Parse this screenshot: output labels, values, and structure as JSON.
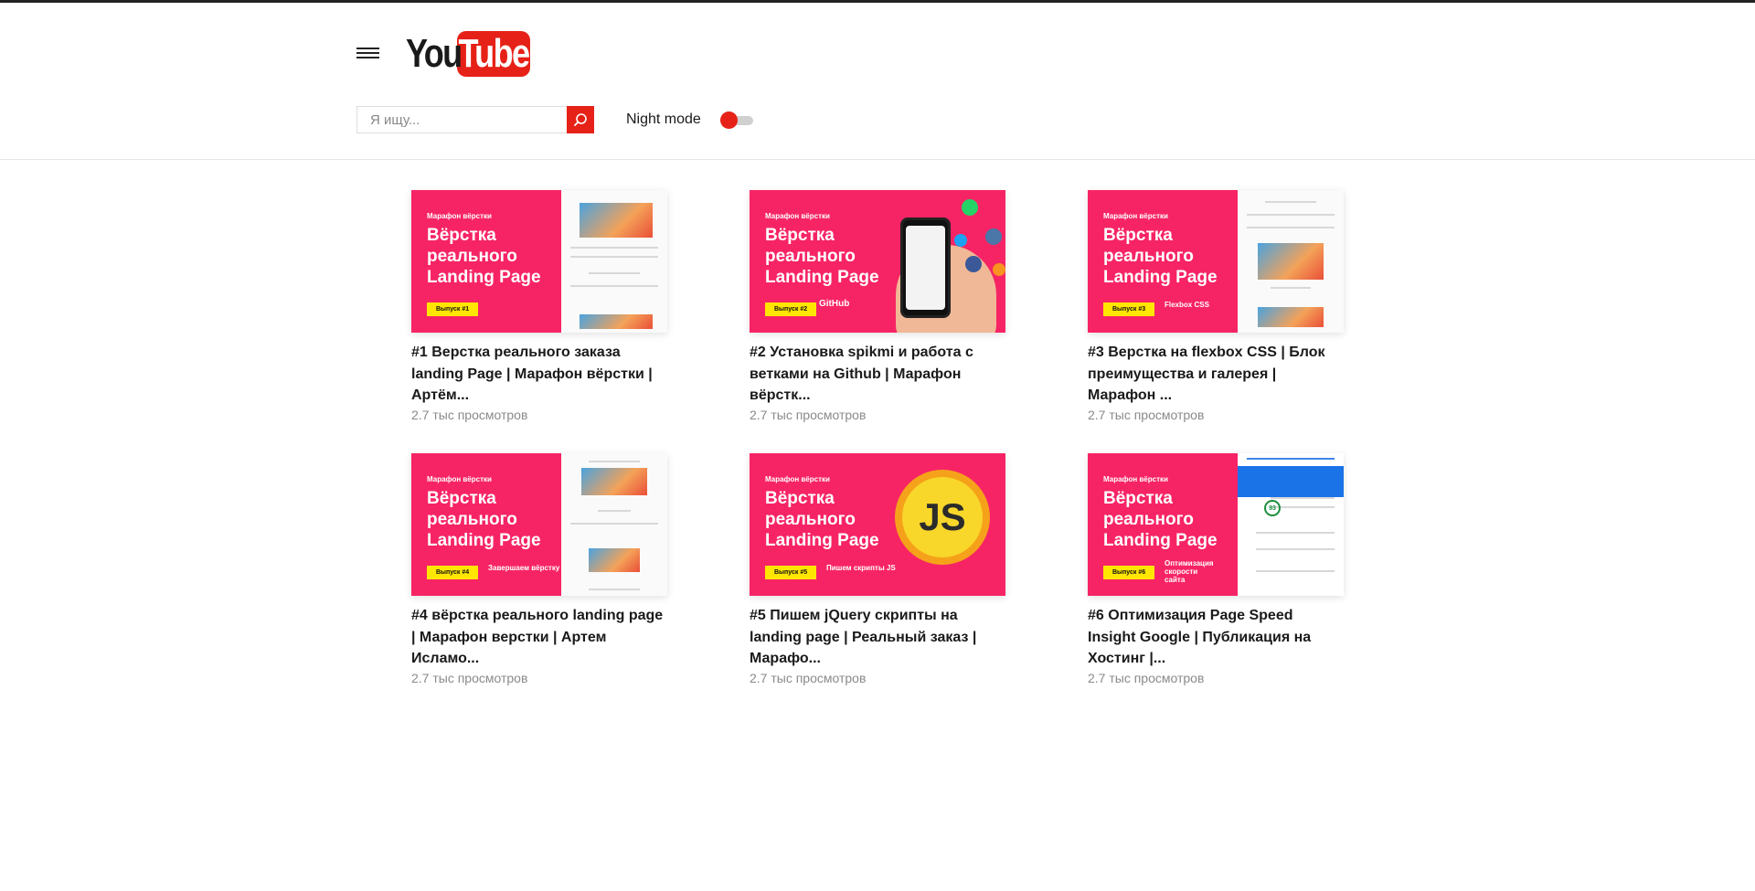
{
  "header": {
    "logo_you": "You",
    "logo_tube": "Tube",
    "search_placeholder": "Я ищу...",
    "night_mode_label": "Night mode",
    "night_mode_on": true
  },
  "thumb_common": {
    "kicker": "Марафон вёрстки",
    "line1": "Вёрстка",
    "line2": "реального",
    "line3": "Landing Page"
  },
  "videos": [
    {
      "title": "#1 Верстка реального заказа landing Page | Марафон вёрстки | Артём...",
      "views": "2.7 тыс просмотров",
      "badge": "Выпуск #1",
      "sub": ""
    },
    {
      "title": "#2 Установка spikmi и работа с ветками на Github | Марафон вёрстк...",
      "views": "2.7 тыс просмотров",
      "badge": "Выпуск #2",
      "sub": "GitHub"
    },
    {
      "title": "#3 Верстка на flexbox CSS | Блок преимущества и галерея | Марафон ...",
      "views": "2.7 тыс просмотров",
      "badge": "Выпуск #3",
      "sub": "Flexbox CSS"
    },
    {
      "title": "#4 вёрстка реального landing page | Марафон верстки | Артем Исламо...",
      "views": "2.7 тыс просмотров",
      "badge": "Выпуск #4",
      "sub": "Завершаем вёрстку"
    },
    {
      "title": "#5 Пишем jQuery скрипты на landing page | Реальный заказ | Марафо...",
      "views": "2.7 тыс просмотров",
      "badge": "Выпуск #5",
      "sub": "Пишем скрипты JS",
      "js": "JS"
    },
    {
      "title": "#6 Оптимизация Page Speed Insight Google | Публикация на Хостинг |...",
      "views": "2.7 тыс просмотров",
      "badge": "Выпуск #6",
      "sub": "Оптимизация скорости сайта",
      "score": "93"
    }
  ]
}
